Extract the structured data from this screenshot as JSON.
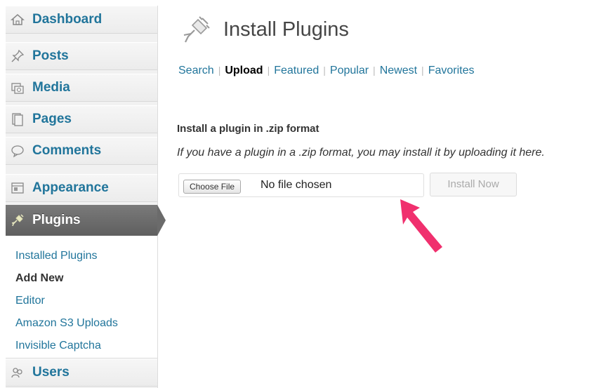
{
  "sidebar": {
    "items": [
      {
        "label": "Dashboard",
        "icon": "dashboard-icon"
      },
      {
        "label": "Posts",
        "icon": "pushpin-icon"
      },
      {
        "label": "Media",
        "icon": "media-icon"
      },
      {
        "label": "Pages",
        "icon": "pages-icon"
      },
      {
        "label": "Comments",
        "icon": "comment-bubble-icon"
      },
      {
        "label": "Appearance",
        "icon": "appearance-icon"
      },
      {
        "label": "Plugins",
        "icon": "plug-icon"
      },
      {
        "label": "Users",
        "icon": "users-icon"
      }
    ],
    "plugins_submenu": [
      "Installed Plugins",
      "Add New",
      "Editor",
      "Amazon S3 Uploads",
      "Invisible Captcha"
    ],
    "current_submenu": "Add New"
  },
  "main": {
    "title": "Install Plugins",
    "tabs": [
      {
        "label": "Search"
      },
      {
        "label": "Upload"
      },
      {
        "label": "Featured"
      },
      {
        "label": "Popular"
      },
      {
        "label": "Newest"
      },
      {
        "label": "Favorites"
      }
    ],
    "current_tab": "Upload",
    "tab_separator": "|",
    "section_heading": "Install a plugin in .zip format",
    "section_description": "If you have a plugin in a .zip format, you may install it by uploading it here.",
    "file_input": {
      "button_label": "Choose File",
      "status": "No file chosen"
    },
    "install_button_label": "Install Now"
  },
  "colors": {
    "link": "#21759b",
    "current_menu_bg": "#6b6b6b",
    "annotation_arrow": "#f0306e",
    "sidebar_bg": "#f1f1f1"
  }
}
